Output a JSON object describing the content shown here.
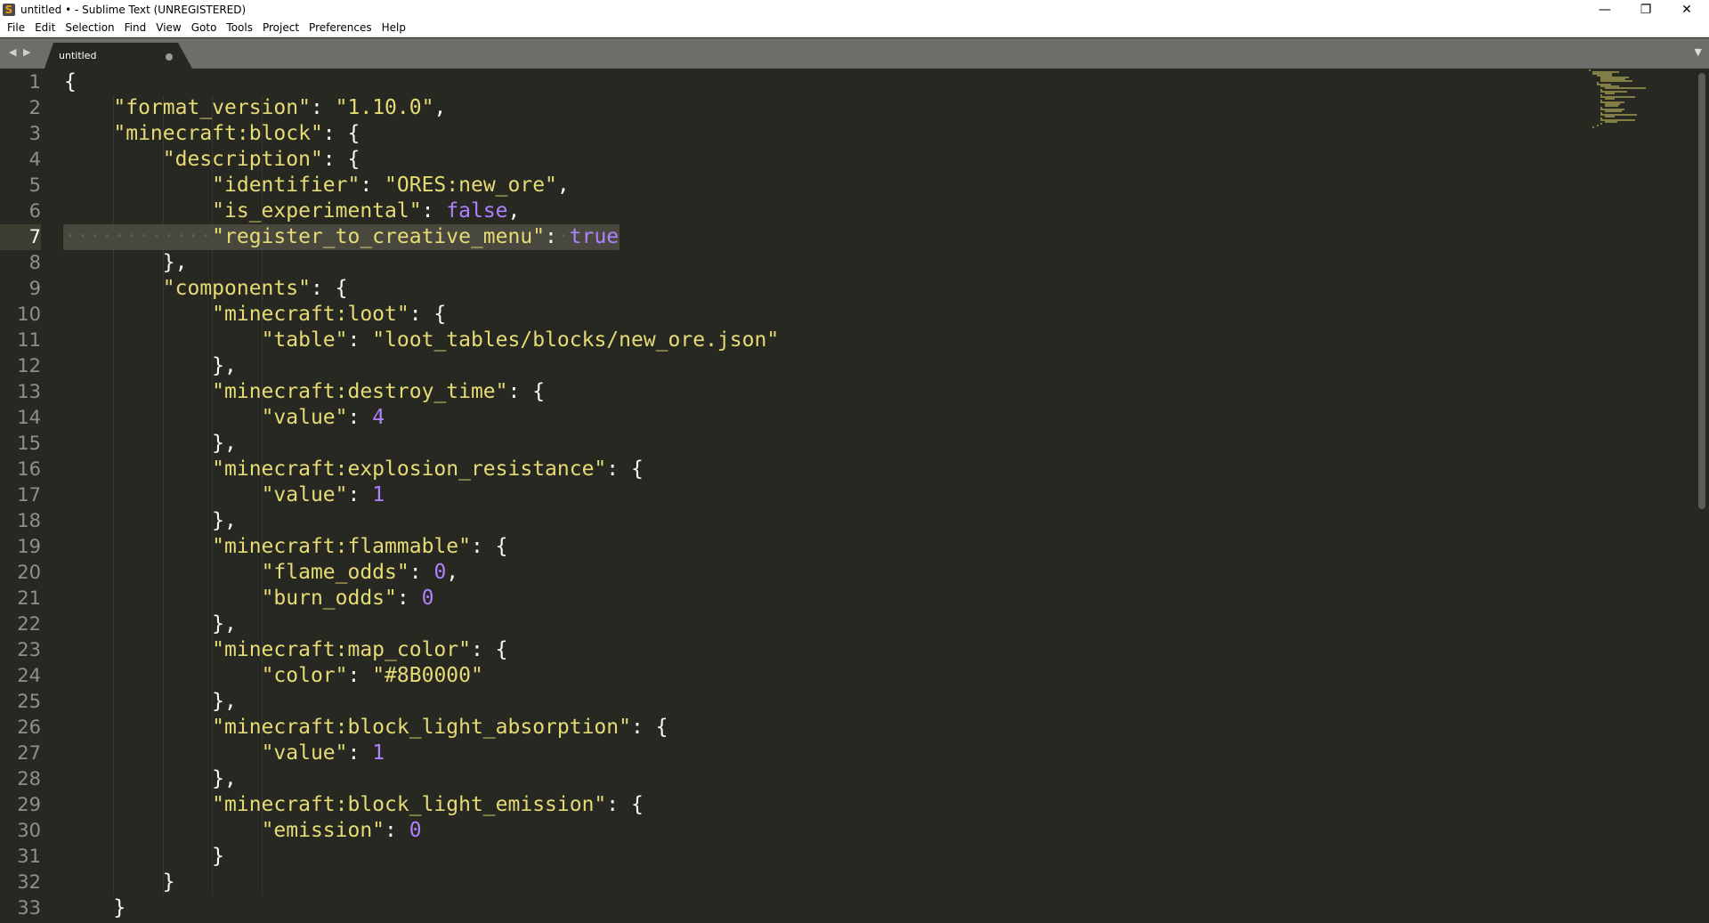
{
  "window": {
    "title": "untitled • - Sublime Text (UNREGISTERED)",
    "minimize": "—",
    "restore": "❐",
    "close": "✕",
    "icon": "sublime-logo"
  },
  "menu": [
    "File",
    "Edit",
    "Selection",
    "Find",
    "View",
    "Goto",
    "Tools",
    "Project",
    "Preferences",
    "Help"
  ],
  "tabs": [
    {
      "label": "untitled",
      "dirty": true
    }
  ],
  "nav": "◀ ▶",
  "tab_menu": "▼",
  "editor": {
    "current_line": 7,
    "colors": {
      "bg": "#272822",
      "string": "#e6db74",
      "number": "#ae81ff",
      "text": "#f8f8f2"
    },
    "lines": [
      [
        [
          "p",
          "{"
        ]
      ],
      [
        [
          "p",
          "    "
        ],
        [
          "s",
          "\"format_version\""
        ],
        [
          "p",
          ": "
        ],
        [
          "s",
          "\"1.10.0\""
        ],
        [
          "p",
          ","
        ]
      ],
      [
        [
          "p",
          "    "
        ],
        [
          "s",
          "\"minecraft:block\""
        ],
        [
          "p",
          ": {"
        ]
      ],
      [
        [
          "p",
          "        "
        ],
        [
          "s",
          "\"description\""
        ],
        [
          "p",
          ": {"
        ]
      ],
      [
        [
          "p",
          "            "
        ],
        [
          "s",
          "\"identifier\""
        ],
        [
          "p",
          ": "
        ],
        [
          "s",
          "\"ORES:new_ore\""
        ],
        [
          "p",
          ","
        ]
      ],
      [
        [
          "p",
          "            "
        ],
        [
          "s",
          "\"is_experimental\""
        ],
        [
          "p",
          ": "
        ],
        [
          "n",
          "false"
        ],
        [
          "p",
          ","
        ]
      ],
      [
        [
          "ws",
          "············"
        ],
        [
          "s",
          "\"register_to_creative_menu\""
        ],
        [
          "p",
          ":"
        ],
        [
          "ws",
          "·"
        ],
        [
          "n",
          "true"
        ]
      ],
      [
        [
          "p",
          "        },"
        ]
      ],
      [
        [
          "p",
          "        "
        ],
        [
          "s",
          "\"components\""
        ],
        [
          "p",
          ": {"
        ]
      ],
      [
        [
          "p",
          "            "
        ],
        [
          "s",
          "\"minecraft:loot\""
        ],
        [
          "p",
          ": {"
        ]
      ],
      [
        [
          "p",
          "                "
        ],
        [
          "s",
          "\"table\""
        ],
        [
          "p",
          ": "
        ],
        [
          "s",
          "\"loot_tables/blocks/new_ore.json\""
        ]
      ],
      [
        [
          "p",
          "            },"
        ]
      ],
      [
        [
          "p",
          "            "
        ],
        [
          "s",
          "\"minecraft:destroy_time\""
        ],
        [
          "p",
          ": {"
        ]
      ],
      [
        [
          "p",
          "                "
        ],
        [
          "s",
          "\"value\""
        ],
        [
          "p",
          ": "
        ],
        [
          "n",
          "4"
        ]
      ],
      [
        [
          "p",
          "            },"
        ]
      ],
      [
        [
          "p",
          "            "
        ],
        [
          "s",
          "\"minecraft:explosion_resistance\""
        ],
        [
          "p",
          ": {"
        ]
      ],
      [
        [
          "p",
          "                "
        ],
        [
          "s",
          "\"value\""
        ],
        [
          "p",
          ": "
        ],
        [
          "n",
          "1"
        ]
      ],
      [
        [
          "p",
          "            },"
        ]
      ],
      [
        [
          "p",
          "            "
        ],
        [
          "s",
          "\"minecraft:flammable\""
        ],
        [
          "p",
          ": {"
        ]
      ],
      [
        [
          "p",
          "                "
        ],
        [
          "s",
          "\"flame_odds\""
        ],
        [
          "p",
          ": "
        ],
        [
          "n",
          "0"
        ],
        [
          "p",
          ","
        ]
      ],
      [
        [
          "p",
          "                "
        ],
        [
          "s",
          "\"burn_odds\""
        ],
        [
          "p",
          ": "
        ],
        [
          "n",
          "0"
        ]
      ],
      [
        [
          "p",
          "            },"
        ]
      ],
      [
        [
          "p",
          "            "
        ],
        [
          "s",
          "\"minecraft:map_color\""
        ],
        [
          "p",
          ": {"
        ]
      ],
      [
        [
          "p",
          "                "
        ],
        [
          "s",
          "\"color\""
        ],
        [
          "p",
          ": "
        ],
        [
          "s",
          "\"#8B0000\""
        ]
      ],
      [
        [
          "p",
          "            },"
        ]
      ],
      [
        [
          "p",
          "            "
        ],
        [
          "s",
          "\"minecraft:block_light_absorption\""
        ],
        [
          "p",
          ": {"
        ]
      ],
      [
        [
          "p",
          "                "
        ],
        [
          "s",
          "\"value\""
        ],
        [
          "p",
          ": "
        ],
        [
          "n",
          "1"
        ]
      ],
      [
        [
          "p",
          "            },"
        ]
      ],
      [
        [
          "p",
          "            "
        ],
        [
          "s",
          "\"minecraft:block_light_emission\""
        ],
        [
          "p",
          ": {"
        ]
      ],
      [
        [
          "p",
          "                "
        ],
        [
          "s",
          "\"emission\""
        ],
        [
          "p",
          ": "
        ],
        [
          "n",
          "0"
        ]
      ],
      [
        [
          "p",
          "            }"
        ]
      ],
      [
        [
          "p",
          "        }"
        ]
      ],
      [
        [
          "p",
          "    }"
        ]
      ]
    ]
  }
}
